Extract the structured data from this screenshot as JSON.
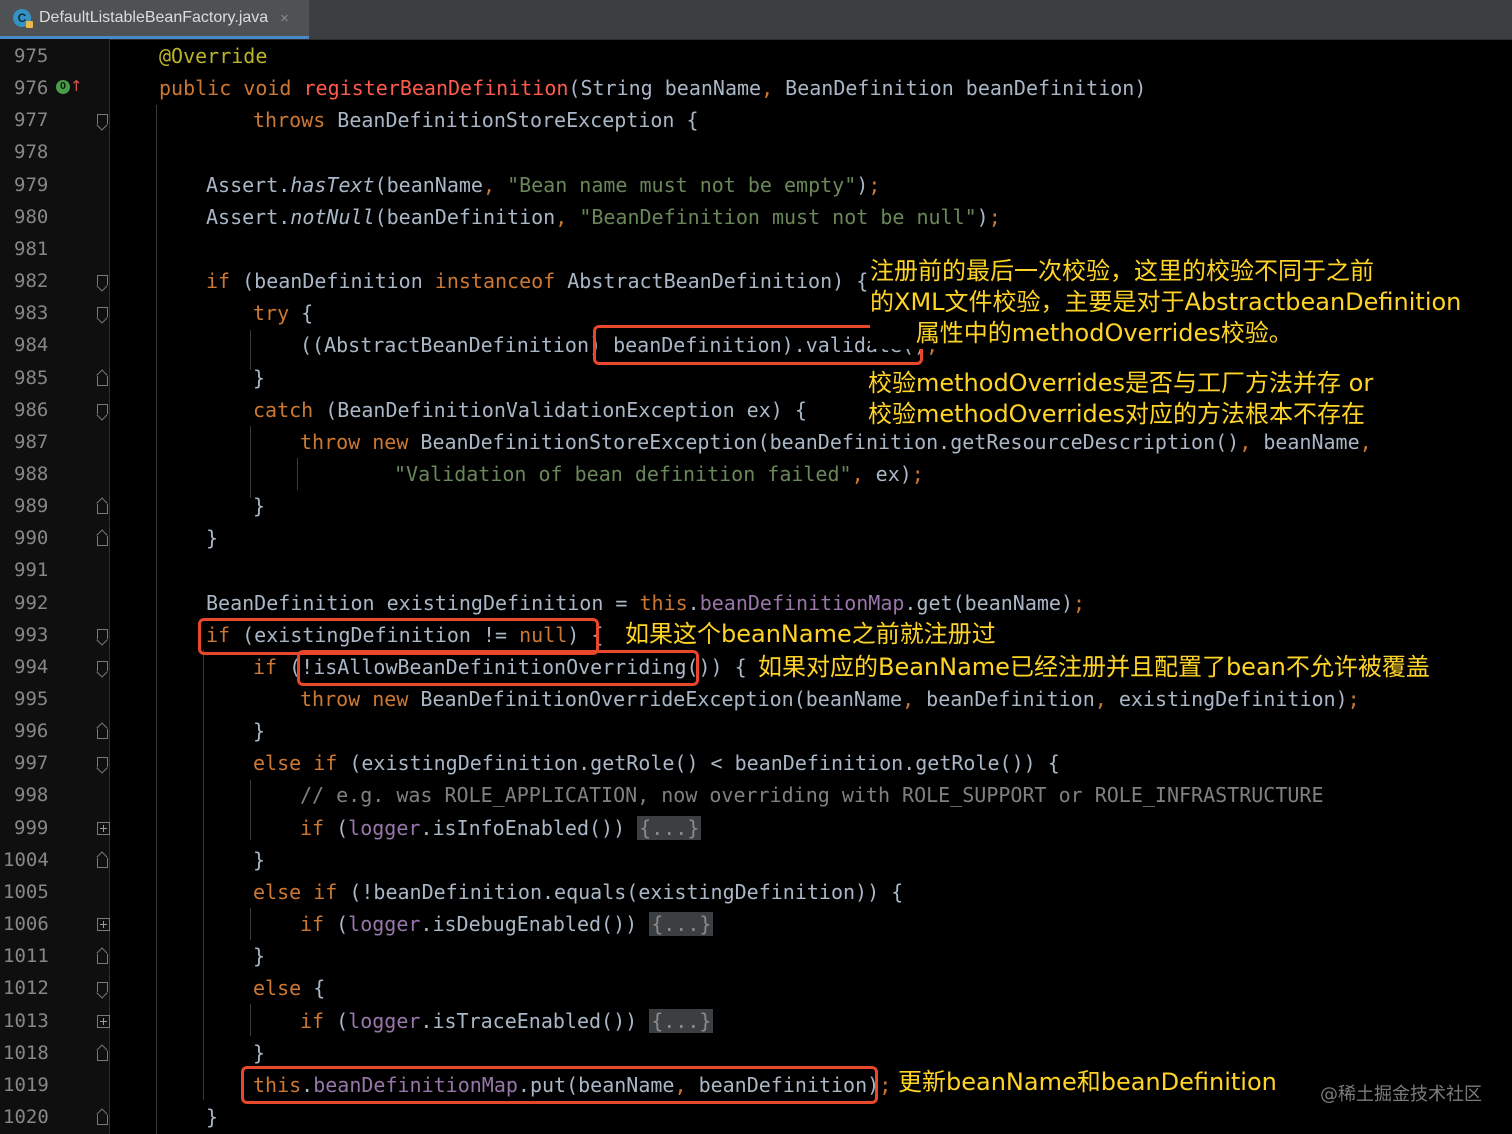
{
  "tab": {
    "file_icon_letter": "C",
    "filename": "DefaultListableBeanFactory.java",
    "close_glyph": "×"
  },
  "gutter": {
    "line_numbers": [
      "975",
      "976",
      "977",
      "978",
      "979",
      "980",
      "981",
      "982",
      "983",
      "984",
      "985",
      "986",
      "987",
      "988",
      "989",
      "990",
      "991",
      "992",
      "993",
      "994",
      "995",
      "996",
      "997",
      "998",
      "999",
      "1004",
      "1005",
      "1006",
      "1011",
      "1012",
      "1013",
      "1018",
      "1019",
      "1020"
    ]
  },
  "code_lines": [
    [
      {
        "t": "@Override",
        "c": "ann"
      }
    ],
    [
      {
        "t": "public void ",
        "c": "kw"
      },
      {
        "t": "registerBeanDefinition",
        "c": "red"
      },
      {
        "t": "(String beanName",
        "c": ""
      },
      {
        "t": ", ",
        "c": "kw"
      },
      {
        "t": "BeanDefinition beanDefinition)",
        "c": ""
      }
    ],
    [
      {
        "t": "throws ",
        "c": "kw"
      },
      {
        "t": "BeanDefinitionStoreException {",
        "c": ""
      }
    ],
    [],
    [
      {
        "t": "Assert.",
        "c": ""
      },
      {
        "t": "hasText",
        "c": "itl"
      },
      {
        "t": "(beanName",
        "c": ""
      },
      {
        "t": ", ",
        "c": "kw"
      },
      {
        "t": "\"Bean name must not be empty\"",
        "c": "str"
      },
      {
        "t": ")",
        "c": ""
      },
      {
        "t": ";",
        "c": "kw"
      }
    ],
    [
      {
        "t": "Assert.",
        "c": ""
      },
      {
        "t": "notNull",
        "c": "itl"
      },
      {
        "t": "(beanDefinition",
        "c": ""
      },
      {
        "t": ", ",
        "c": "kw"
      },
      {
        "t": "\"BeanDefinition must not be null\"",
        "c": "str"
      },
      {
        "t": ")",
        "c": ""
      },
      {
        "t": ";",
        "c": "kw"
      }
    ],
    [],
    [
      {
        "t": "if ",
        "c": "kw"
      },
      {
        "t": "(beanDefinition ",
        "c": ""
      },
      {
        "t": "instanceof ",
        "c": "kw"
      },
      {
        "t": "AbstractBeanDefinition) {",
        "c": ""
      }
    ],
    [
      {
        "t": "try ",
        "c": "kw"
      },
      {
        "t": "{",
        "c": ""
      }
    ],
    [
      {
        "t": "((AbstractBeanDefinition) beanDefinition).validate()",
        "c": ""
      },
      {
        "t": ";",
        "c": "kw"
      }
    ],
    [
      {
        "t": "}",
        "c": ""
      }
    ],
    [
      {
        "t": "catch ",
        "c": "kw"
      },
      {
        "t": "(BeanDefinitionValidationException ex) {",
        "c": ""
      }
    ],
    [
      {
        "t": "throw new ",
        "c": "kw"
      },
      {
        "t": "BeanDefinitionStoreException(beanDefinition.getResourceDescription()",
        "c": ""
      },
      {
        "t": ", ",
        "c": "kw"
      },
      {
        "t": "beanName",
        "c": ""
      },
      {
        "t": ",",
        "c": "kw"
      }
    ],
    [
      {
        "t": "\"Validation of bean definition failed\"",
        "c": "str"
      },
      {
        "t": ", ",
        "c": "kw"
      },
      {
        "t": "ex)",
        "c": ""
      },
      {
        "t": ";",
        "c": "kw"
      }
    ],
    [
      {
        "t": "}",
        "c": ""
      }
    ],
    [
      {
        "t": "}",
        "c": ""
      }
    ],
    [],
    [
      {
        "t": "BeanDefinition existingDefinition = ",
        "c": ""
      },
      {
        "t": "this",
        "c": "kw"
      },
      {
        "t": ".",
        "c": ""
      },
      {
        "t": "beanDefinitionMap",
        "c": "fld"
      },
      {
        "t": ".get(beanName)",
        "c": ""
      },
      {
        "t": ";",
        "c": "kw"
      }
    ],
    [
      {
        "t": "if ",
        "c": "kw"
      },
      {
        "t": "(existingDefinition != ",
        "c": ""
      },
      {
        "t": "null",
        "c": "kw"
      },
      {
        "t": ") {",
        "c": ""
      }
    ],
    [
      {
        "t": "if ",
        "c": "kw"
      },
      {
        "t": "(!isAllowBeanDefinitionOverriding()) {",
        "c": ""
      }
    ],
    [
      {
        "t": "throw new ",
        "c": "kw"
      },
      {
        "t": "BeanDefinitionOverrideException(beanName",
        "c": ""
      },
      {
        "t": ", ",
        "c": "kw"
      },
      {
        "t": "beanDefinition",
        "c": ""
      },
      {
        "t": ", ",
        "c": "kw"
      },
      {
        "t": "existingDefinition)",
        "c": ""
      },
      {
        "t": ";",
        "c": "kw"
      }
    ],
    [
      {
        "t": "}",
        "c": ""
      }
    ],
    [
      {
        "t": "else if ",
        "c": "kw"
      },
      {
        "t": "(existingDefinition.getRole() < beanDefinition.getRole()) {",
        "c": ""
      }
    ],
    [
      {
        "t": "// e.g. was ROLE_APPLICATION, now overriding with ROLE_SUPPORT or ROLE_INFRASTRUCTURE",
        "c": "cmt"
      }
    ],
    [
      {
        "t": "if ",
        "c": "kw"
      },
      {
        "t": "(",
        "c": ""
      },
      {
        "t": "logger",
        "c": "fld"
      },
      {
        "t": ".isInfoEnabled()) ",
        "c": ""
      },
      {
        "t": "{...}",
        "c": "fold-ph"
      }
    ],
    [
      {
        "t": "}",
        "c": ""
      }
    ],
    [
      {
        "t": "else if ",
        "c": "kw"
      },
      {
        "t": "(!beanDefinition.equals(existingDefinition)) {",
        "c": ""
      }
    ],
    [
      {
        "t": "if ",
        "c": "kw"
      },
      {
        "t": "(",
        "c": ""
      },
      {
        "t": "logger",
        "c": "fld"
      },
      {
        "t": ".isDebugEnabled()) ",
        "c": ""
      },
      {
        "t": "{...}",
        "c": "fold-ph"
      }
    ],
    [
      {
        "t": "}",
        "c": ""
      }
    ],
    [
      {
        "t": "else ",
        "c": "kw"
      },
      {
        "t": "{",
        "c": ""
      }
    ],
    [
      {
        "t": "if ",
        "c": "kw"
      },
      {
        "t": "(",
        "c": ""
      },
      {
        "t": "logger",
        "c": "fld"
      },
      {
        "t": ".isTraceEnabled()) ",
        "c": ""
      },
      {
        "t": "{...}",
        "c": "fold-ph"
      }
    ],
    [
      {
        "t": "}",
        "c": ""
      }
    ],
    [
      {
        "t": "this",
        "c": "kw"
      },
      {
        "t": ".",
        "c": ""
      },
      {
        "t": "beanDefinitionMap",
        "c": "fld"
      },
      {
        "t": ".put(beanName",
        "c": ""
      },
      {
        "t": ", ",
        "c": "kw"
      },
      {
        "t": "beanDefinition)",
        "c": ""
      },
      {
        "t": ";",
        "c": "kw"
      }
    ],
    [
      {
        "t": "}",
        "c": ""
      }
    ]
  ],
  "annotations": {
    "validate_note": "注册前的最后一次校验，这里的校验不同于之前\n的XML文件校验，主要是对于AbstractbeanDefinition\n      属性中的methodOverrides校验。",
    "overrides_note": "校验methodOverrides是否与工厂方法并存 or\n校验methodOverrides对应的方法根本不存在",
    "existing_note": "如果这个beanName之前就注册过",
    "overriding_note": "如果对应的BeanName已经注册并且配置了bean不允许被覆盖",
    "put_note": "更新beanName和beanDefinition"
  },
  "watermark": "@稀土掘金技术社区",
  "colors": {
    "keyword": "#cc7832",
    "method_highlight": "#ff5a4d",
    "string": "#6a8759",
    "field": "#9876aa",
    "annotation_text": "#ffd426",
    "box_border": "#e8472b"
  }
}
